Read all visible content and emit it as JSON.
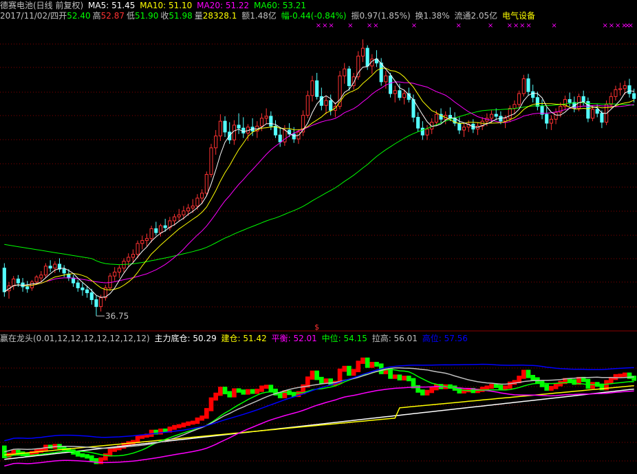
{
  "colors": {
    "background": "#000000",
    "grid": "#8b0000",
    "up": "#ff3232",
    "down": "#54ffff",
    "label": "#c0c0c0",
    "ma5": "#ffffff",
    "ma10": "#ffff00",
    "ma20": "#ff00ff",
    "ma60": "#00ff00",
    "ind_up": "#ff0000",
    "ind_down": "#00ff00",
    "zhuli": "#ffffff",
    "jiancang": "#ffff00",
    "pingheng": "#ff00ff",
    "zhongwei": "#00ff00",
    "lagao": "#c0c0c0",
    "gaowei": "#0000ff",
    "industry": "#ffff00",
    "marker": "#ff00ff",
    "signal": "#ff3232"
  },
  "header": {
    "stock_name": "德赛电池(日线 前复权)",
    "ma5": "MA5: 51.45",
    "ma10": "MA10: 51.10",
    "ma20": "MA20: 51.22",
    "ma60": "MA60: 53.21"
  },
  "quote": {
    "date": "2017/11/02/四",
    "open_label": "开",
    "open": "52.40",
    "high_label": "高",
    "high": "52.87",
    "low_label": "低",
    "low": "51.90",
    "close_label": "收",
    "close": "51.98",
    "volume_label": "量",
    "volume": "28328.1",
    "amount": "额1.48亿",
    "change": "幅-0.44(-0.84%)",
    "amplitude": "振0.97(1.85%)",
    "turnover": "换1.38%",
    "float_cap": "流通2.05亿",
    "industry": "电气设备"
  },
  "indicator": {
    "name": "赢在龙头(0.01,12,12,12,12,12,12,12)",
    "zhuli": "主力底仓: 50.29",
    "jiancang": "建仓: 51.42",
    "pingheng": "平衡: 52.01",
    "zhongwei": "中位: 54.15",
    "lagao": "拉高: 56.01",
    "gaowei": "高位: 57.56"
  },
  "chart_data": {
    "type": "candlestick",
    "low_annotation": "36.75",
    "signal_marker": "$",
    "marker_glyph": "×",
    "ylim": [
      36,
      66
    ],
    "ohlc": [
      [
        41.6,
        42.1,
        38.7,
        39.2
      ],
      [
        39.3,
        40.2,
        38.5,
        39.8
      ],
      [
        39.8,
        40.8,
        39.4,
        40.5
      ],
      [
        40.5,
        40.9,
        39.7,
        40.1
      ],
      [
        40.1,
        40.6,
        39.2,
        39.7
      ],
      [
        39.7,
        40.3,
        39.1,
        39.5
      ],
      [
        39.6,
        40.4,
        39.3,
        40.2
      ],
      [
        40.2,
        40.9,
        39.9,
        40.7
      ],
      [
        40.6,
        41.3,
        40.2,
        40.9
      ],
      [
        40.9,
        42.1,
        40.6,
        41.8
      ],
      [
        41.8,
        42.4,
        41.2,
        41.6
      ],
      [
        41.6,
        42.3,
        41.1,
        42.0
      ],
      [
        42.0,
        42.6,
        41.2,
        41.5
      ],
      [
        41.5,
        41.9,
        40.7,
        41.1
      ],
      [
        41.0,
        41.5,
        40.3,
        40.6
      ],
      [
        40.6,
        40.9,
        39.7,
        40.1
      ],
      [
        40.1,
        40.4,
        39.2,
        39.6
      ],
      [
        39.6,
        40.1,
        38.8,
        39.4
      ],
      [
        39.4,
        39.8,
        38.6,
        39.1
      ],
      [
        39.1,
        39.5,
        37.9,
        38.4
      ],
      [
        38.4,
        38.8,
        36.75,
        37.7
      ],
      [
        37.7,
        38.9,
        37.2,
        38.6
      ],
      [
        38.6,
        39.9,
        38.3,
        39.6
      ],
      [
        39.6,
        41.1,
        39.3,
        40.8
      ],
      [
        40.8,
        41.7,
        40.3,
        41.2
      ],
      [
        41.2,
        41.9,
        40.6,
        41.6
      ],
      [
        41.6,
        42.6,
        41.2,
        42.3
      ],
      [
        42.3,
        43.1,
        41.8,
        42.7
      ],
      [
        42.7,
        43.5,
        42.1,
        43.0
      ],
      [
        43.0,
        44.4,
        42.6,
        44.1
      ],
      [
        44.1,
        44.9,
        43.5,
        44.4
      ],
      [
        44.4,
        45.1,
        43.8,
        44.6
      ],
      [
        44.6,
        45.9,
        44.2,
        45.6
      ],
      [
        45.6,
        46.3,
        44.9,
        45.2
      ],
      [
        45.2,
        46.1,
        44.8,
        45.9
      ],
      [
        45.9,
        46.6,
        45.3,
        45.7
      ],
      [
        45.7,
        46.8,
        45.4,
        46.4
      ],
      [
        46.4,
        47.1,
        45.9,
        46.8
      ],
      [
        46.8,
        47.6,
        46.3,
        47.0
      ],
      [
        47.0,
        47.9,
        46.5,
        47.4
      ],
      [
        47.4,
        48.1,
        46.9,
        47.7
      ],
      [
        47.7,
        48.6,
        47.2,
        47.9
      ],
      [
        47.9,
        49.1,
        47.5,
        48.7
      ],
      [
        48.7,
        49.6,
        48.1,
        49.2
      ],
      [
        49.2,
        51.4,
        48.9,
        51.1
      ],
      [
        51.1,
        54.2,
        50.8,
        53.8
      ],
      [
        53.8,
        55.6,
        53.1,
        55.0
      ],
      [
        55.0,
        57.2,
        54.5,
        56.5
      ],
      [
        56.5,
        57.0,
        54.9,
        55.4
      ],
      [
        55.4,
        56.4,
        54.2,
        54.6
      ],
      [
        54.6,
        56.6,
        54.1,
        56.1
      ],
      [
        56.1,
        57.3,
        55.2,
        55.8
      ],
      [
        55.8,
        56.9,
        54.8,
        55.3
      ],
      [
        55.3,
        56.2,
        54.5,
        55.9
      ],
      [
        55.9,
        56.8,
        55.0,
        55.5
      ],
      [
        55.5,
        56.5,
        54.8,
        56.0
      ],
      [
        56.0,
        57.3,
        55.5,
        56.8
      ],
      [
        56.8,
        57.8,
        56.2,
        57.0
      ],
      [
        57.0,
        57.5,
        55.6,
        56.0
      ],
      [
        56.0,
        56.6,
        54.8,
        55.1
      ],
      [
        55.1,
        55.8,
        53.9,
        54.4
      ],
      [
        54.4,
        56.1,
        54.0,
        55.6
      ],
      [
        55.6,
        56.3,
        54.9,
        55.2
      ],
      [
        55.2,
        55.9,
        54.3,
        54.7
      ],
      [
        54.7,
        55.7,
        54.2,
        55.4
      ],
      [
        55.4,
        57.6,
        55.0,
        57.1
      ],
      [
        57.1,
        59.6,
        56.8,
        59.1
      ],
      [
        59.1,
        61.1,
        58.5,
        60.6
      ],
      [
        60.6,
        61.4,
        58.7,
        59.0
      ],
      [
        59.0,
        59.9,
        57.6,
        58.1
      ],
      [
        58.1,
        59.0,
        57.2,
        58.6
      ],
      [
        58.6,
        59.2,
        57.1,
        57.6
      ],
      [
        57.6,
        58.4,
        56.9,
        58.0
      ],
      [
        58.0,
        61.6,
        57.7,
        61.1
      ],
      [
        61.1,
        62.4,
        60.3,
        61.8
      ],
      [
        61.8,
        62.1,
        59.6,
        60.1
      ],
      [
        60.1,
        61.4,
        59.7,
        61.0
      ],
      [
        61.0,
        63.6,
        60.7,
        63.1
      ],
      [
        63.1,
        64.8,
        62.5,
        63.9
      ],
      [
        63.9,
        64.2,
        61.7,
        62.1
      ],
      [
        62.1,
        63.3,
        61.3,
        62.8
      ],
      [
        62.8,
        63.7,
        62.0,
        62.4
      ],
      [
        62.4,
        62.9,
        60.1,
        60.5
      ],
      [
        60.5,
        61.6,
        59.8,
        61.1
      ],
      [
        61.1,
        61.4,
        58.9,
        59.3
      ],
      [
        59.3,
        60.1,
        58.4,
        59.6
      ],
      [
        59.6,
        60.3,
        58.6,
        58.9
      ],
      [
        58.9,
        59.7,
        58.2,
        59.3
      ],
      [
        59.3,
        59.9,
        58.4,
        58.7
      ],
      [
        58.7,
        59.2,
        56.4,
        56.9
      ],
      [
        56.9,
        57.4,
        55.4,
        55.8
      ],
      [
        55.8,
        56.5,
        54.6,
        55.1
      ],
      [
        55.1,
        56.1,
        54.6,
        55.7
      ],
      [
        55.7,
        56.8,
        55.2,
        56.4
      ],
      [
        56.4,
        57.6,
        56.0,
        57.2
      ],
      [
        57.2,
        57.8,
        56.3,
        56.7
      ],
      [
        56.7,
        57.5,
        56.2,
        57.1
      ],
      [
        57.1,
        57.9,
        56.5,
        56.8
      ],
      [
        56.8,
        57.4,
        56.0,
        56.3
      ],
      [
        56.3,
        56.9,
        55.2,
        55.6
      ],
      [
        55.6,
        56.3,
        54.9,
        55.9
      ],
      [
        55.9,
        56.6,
        55.4,
        56.2
      ],
      [
        56.2,
        56.7,
        55.3,
        55.7
      ],
      [
        55.7,
        56.4,
        55.1,
        56.0
      ],
      [
        56.0,
        56.9,
        55.6,
        56.5
      ],
      [
        56.5,
        57.3,
        56.0,
        56.8
      ],
      [
        56.8,
        57.6,
        56.3,
        57.2
      ],
      [
        57.2,
        57.8,
        56.6,
        57.0
      ],
      [
        57.0,
        57.5,
        56.2,
        56.5
      ],
      [
        56.5,
        57.1,
        55.8,
        56.8
      ],
      [
        56.8,
        58.1,
        56.4,
        57.8
      ],
      [
        57.8,
        58.6,
        57.2,
        58.2
      ],
      [
        58.2,
        59.6,
        57.9,
        59.3
      ],
      [
        59.3,
        61.2,
        59.0,
        60.8
      ],
      [
        60.8,
        61.3,
        59.1,
        59.5
      ],
      [
        59.5,
        60.2,
        58.4,
        58.9
      ],
      [
        58.9,
        59.5,
        57.6,
        58.0
      ],
      [
        58.0,
        58.7,
        56.7,
        57.2
      ],
      [
        57.2,
        57.9,
        55.7,
        56.3
      ],
      [
        56.3,
        57.1,
        55.6,
        56.7
      ],
      [
        56.7,
        57.8,
        56.2,
        57.4
      ],
      [
        57.4,
        58.4,
        56.9,
        58.0
      ],
      [
        58.0,
        59.1,
        57.6,
        58.7
      ],
      [
        58.7,
        59.4,
        58.0,
        58.4
      ],
      [
        58.4,
        59.0,
        57.4,
        57.8
      ],
      [
        57.8,
        59.3,
        57.5,
        59.0
      ],
      [
        59.0,
        59.6,
        58.1,
        58.5
      ],
      [
        58.5,
        58.9,
        56.4,
        56.8
      ],
      [
        56.8,
        58.1,
        56.5,
        57.7
      ],
      [
        57.7,
        58.2,
        56.9,
        57.3
      ],
      [
        57.3,
        57.6,
        55.8,
        56.4
      ],
      [
        56.4,
        58.6,
        56.1,
        58.2
      ],
      [
        58.2,
        59.4,
        57.8,
        59.0
      ],
      [
        59.0,
        60.1,
        58.6,
        59.7
      ],
      [
        59.7,
        60.4,
        59.1,
        59.8
      ],
      [
        59.8,
        60.6,
        59.2,
        60.1
      ],
      [
        60.1,
        60.8,
        58.9,
        59.3
      ],
      [
        59.3,
        59.8,
        58.4,
        58.8
      ]
    ],
    "series_labels": [
      "主力底仓",
      "建仓",
      "平衡",
      "中位",
      "拉高",
      "高位"
    ]
  }
}
